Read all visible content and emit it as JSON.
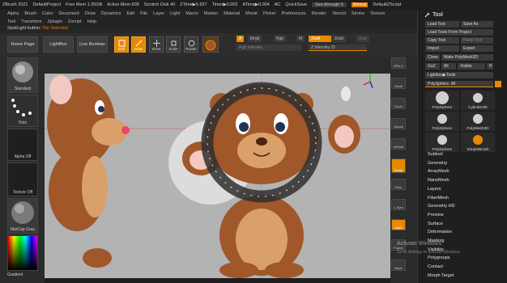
{
  "titlebar": {
    "app": "ZBrush 2021",
    "project": "DefaultProject",
    "free_mem": "Free Mem 1.35GB",
    "active_mem": "Active Mem 609",
    "scratch": "Scratch Disk 40",
    "ztime": "ZTime▶5.927",
    "timer": "Timer▶0.002",
    "atime": "ATime▶0.004",
    "ac": "AC",
    "quicksave": "QuickSave",
    "see_through": "See-through  0",
    "menus": "Menus",
    "script": "DefaultZScript"
  },
  "menubar": [
    "Alpha",
    "Brush",
    "Color",
    "Document",
    "Draw",
    "Dynamics",
    "Edit",
    "File",
    "Layer",
    "Light",
    "Macro",
    "Marker",
    "Material",
    "Movie",
    "Picker",
    "Preferences",
    "Render",
    "Stencil",
    "Stroke",
    "Texture"
  ],
  "menubar2": [
    "Tool",
    "Transform",
    "Zplugin",
    "Zscript",
    "Help"
  ],
  "spotlight": {
    "label": "SpotLight button:",
    "value": "Tile Selected"
  },
  "toolbar": {
    "home_page": "Home Page",
    "lightbox": "LightBox",
    "live_boolean": "Live Boolean",
    "edit": "Edit",
    "draw": "Draw",
    "move": "Move",
    "scale": "Scale",
    "rotate": "Rotate",
    "a": "A",
    "mrgb": "Mrgb",
    "rgb": "Rgb",
    "m": "M",
    "zadd": "Zadd",
    "zsub": "Zsub",
    "zcut": "Zcut",
    "rgb_intensity": "Rgb Intensity",
    "z_intensity": "Z Intensity 25"
  },
  "leftshelf": {
    "standard": "Standard",
    "dots": "Dots",
    "alpha_off": "Alpha Off",
    "texture_off": "Texture Off",
    "matcap_gray": "MatCap Gray",
    "gradient": "Gradient"
  },
  "rightshelf": [
    "SPix 3",
    "Scroll",
    "Zoom",
    "Actual",
    "AAHalf",
    "Persp",
    "Floor",
    "L.Sym",
    "Qxyz",
    "Frame",
    "Move"
  ],
  "toolpanel": {
    "title": "Tool",
    "load_tool": "Load Tool",
    "save_as": "Save As",
    "load_tools_from_project": "Load Tools From Project",
    "copy_tool": "Copy Tool",
    "paste_tool": "Paste Tool",
    "import": "Import",
    "export": "Export",
    "clone": "Clone",
    "make_polymesh": "Make PolyMesh3D",
    "goz": "GoZ",
    "all": "All",
    "visible": "Visible",
    "r": "R",
    "lightbox_tools": "Lightbox▶Tools",
    "polysphere_48": "PolySphere. 48",
    "thumbs": [
      "PolySphere",
      "Cylinder3D",
      "PolySphere",
      "PolyMesh3D",
      "PolySphere",
      "SimpleBrush"
    ],
    "list": [
      "Subtool",
      "Geometry",
      "ArrayMesh",
      "NanoMesh",
      "Layers",
      "FiberMesh",
      "Geometry HD",
      "Preview",
      "Surface",
      "Deformation",
      "Masking",
      "Visibility",
      "Polygroups",
      "Contact",
      "Morph Target"
    ]
  },
  "watermark": {
    "line1": "Activate Windows",
    "line2": "Go to Settings to activate Windows."
  },
  "colors": {
    "accent": "#e58a00",
    "canvas": "#b3b3b3",
    "bear_brown": "#a0572a",
    "bear_light": "#d9a06a"
  }
}
